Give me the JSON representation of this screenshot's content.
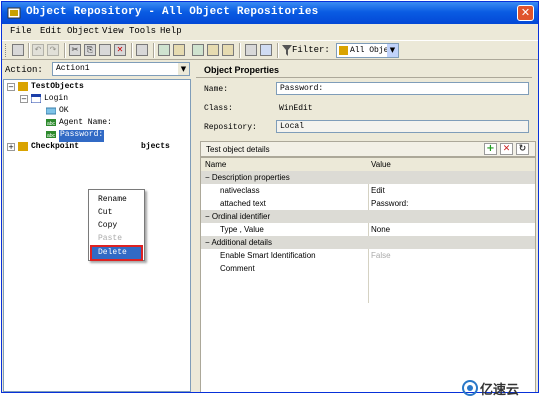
{
  "window": {
    "title": "Object Repository - All Object Repositories",
    "close_glyph": "✕"
  },
  "menu": [
    "File",
    "Edit",
    "Object",
    "View",
    "Tools",
    "Help"
  ],
  "toolbar": {
    "filter_label": "Filter:",
    "filter_value": "All Obje",
    "dropdown_glyph": "▼"
  },
  "action": {
    "label": "Action:",
    "value": "Action1"
  },
  "tree": {
    "root": "TestObjects",
    "login": "Login",
    "ok": "OK",
    "agent_name": "Agent Name:",
    "password": "Password:",
    "checkpoint": "Checkpoint",
    "checkpoint_tail": "bjects"
  },
  "context_menu": {
    "items": [
      "Rename",
      "Cut",
      "Copy",
      "Paste",
      "Delete"
    ],
    "disabled": [
      "Paste"
    ],
    "active": "Delete"
  },
  "properties": {
    "header": "Object Properties",
    "name_label": "Name:",
    "name_value": "Password:",
    "class_label": "Class:",
    "class_value": "WinEdit",
    "repository_label": "Repository:",
    "repository_value": "Local"
  },
  "details": {
    "title": "Test object details",
    "buttons": {
      "add": "+",
      "remove": "✕",
      "refresh": "↻"
    },
    "columns": [
      "Name",
      "Value"
    ],
    "categories": [
      "Description properties",
      "Ordinal identifier",
      "Additional details"
    ],
    "rows": [
      {
        "name": "nativeclass",
        "value": "Edit"
      },
      {
        "name": "attached text",
        "value": "Password:"
      },
      {
        "name": "Type , Value",
        "value": "None"
      },
      {
        "name": "Enable Smart Identification",
        "value": "False"
      },
      {
        "name": "Comment",
        "value": ""
      }
    ]
  },
  "watermark": {
    "text": "亿速云"
  },
  "colors": {
    "title_bar": "#0a5ce3",
    "selection": "#316ac5",
    "highlight_outline": "#dd2222",
    "add_green": "#1f9b1f",
    "remove_red": "#cc2222"
  }
}
